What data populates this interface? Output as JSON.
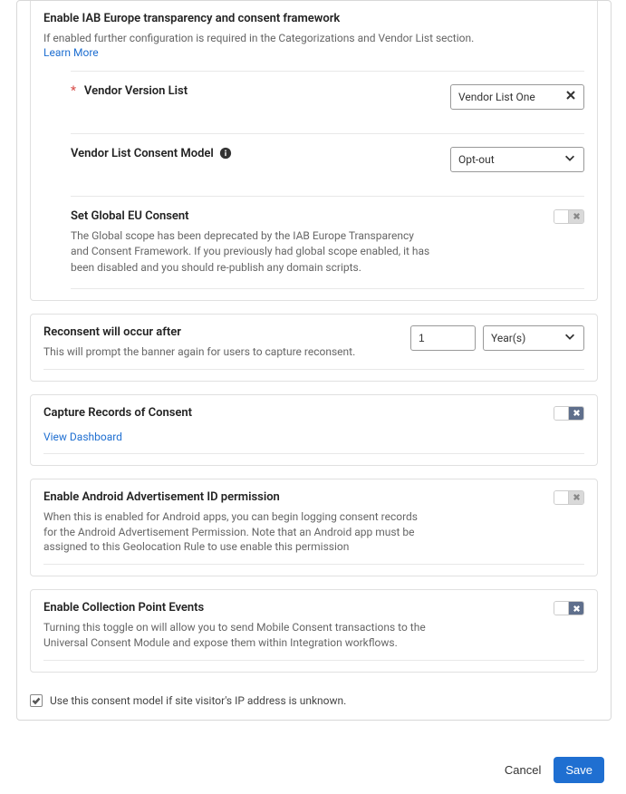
{
  "iab": {
    "title": "Enable IAB Europe transparency and consent framework",
    "desc": "If enabled further configuration is required in the Categorizations and Vendor List section.",
    "learn_more": "Learn More",
    "vendor_version": {
      "label": "Vendor Version List",
      "value": "Vendor List One"
    },
    "consent_model": {
      "label": "Vendor List Consent Model",
      "value": "Opt-out"
    },
    "global_consent": {
      "label": "Set Global EU Consent",
      "desc": "The Global scope has been deprecated by the IAB Europe Transparency and Consent Framework. If you previously had global scope enabled, it has been disabled and you should re-publish any domain scripts."
    }
  },
  "reconsent": {
    "title": "Reconsent will occur after",
    "desc": "This will prompt the banner again for users to capture reconsent.",
    "value": "1",
    "unit": "Year(s)"
  },
  "capture": {
    "title": "Capture Records of Consent",
    "link": "View Dashboard"
  },
  "android": {
    "title": "Enable Android Advertisement ID permission",
    "desc": "When this is enabled for Android apps, you can begin logging consent records for the Android Advertisement Permission. Note that an Android app must be assigned to this Geolocation Rule to use enable this permission"
  },
  "collection": {
    "title": "Enable Collection Point Events",
    "desc": "Turning this toggle on will allow you to send Mobile Consent transactions to the Universal Consent Module and expose them within Integration workflows."
  },
  "fallback": {
    "label": "Use this consent model if site visitor's IP address is unknown."
  },
  "footer": {
    "cancel": "Cancel",
    "save": "Save"
  }
}
